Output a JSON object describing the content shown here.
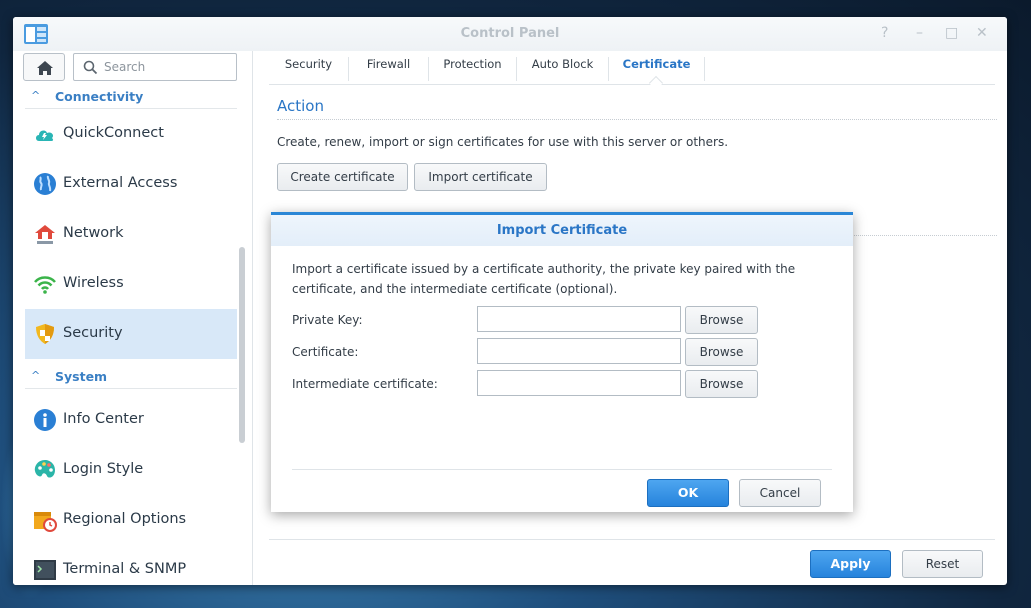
{
  "window": {
    "title": "Control Panel",
    "controls": {
      "help": "?",
      "minimize": "–",
      "maximize": "□",
      "close": "✕"
    }
  },
  "sidebar": {
    "search_placeholder": "Search",
    "groups": [
      {
        "label": "Connectivity",
        "chevron": "^"
      },
      {
        "label": "System",
        "chevron": "^"
      }
    ],
    "items": [
      {
        "label": "QuickConnect",
        "icon": "cloud-icon"
      },
      {
        "label": "External Access",
        "icon": "globe-icon"
      },
      {
        "label": "Network",
        "icon": "home-network-icon"
      },
      {
        "label": "Wireless",
        "icon": "wifi-icon"
      },
      {
        "label": "Security",
        "icon": "shield-icon",
        "active": true
      },
      {
        "label": "Info Center",
        "icon": "info-icon"
      },
      {
        "label": "Login Style",
        "icon": "palette-icon"
      },
      {
        "label": "Regional Options",
        "icon": "calendar-clock-icon"
      },
      {
        "label": "Terminal & SNMP",
        "icon": "terminal-icon"
      }
    ]
  },
  "tabs": [
    {
      "label": "Security"
    },
    {
      "label": "Firewall"
    },
    {
      "label": "Protection"
    },
    {
      "label": "Auto Block"
    },
    {
      "label": "Certificate",
      "active": true
    }
  ],
  "action": {
    "title": "Action",
    "description": "Create, renew, import or sign certificates for use with this server or others.",
    "create_button": "Create certificate",
    "import_button": "Import certificate"
  },
  "footer": {
    "apply": "Apply",
    "reset": "Reset"
  },
  "dialog": {
    "title": "Import Certificate",
    "description": "Import a certificate issued by a certificate authority, the private key paired with the certificate, and the intermediate certificate (optional).",
    "fields": [
      {
        "label": "Private Key:",
        "value": "",
        "browse": "Browse"
      },
      {
        "label": "Certificate:",
        "value": "",
        "browse": "Browse"
      },
      {
        "label": "Intermediate certificate:",
        "value": "",
        "browse": "Browse"
      }
    ],
    "ok": "OK",
    "cancel": "Cancel"
  },
  "colors": {
    "accent": "#2a76c6",
    "primary_button": "#2683dc",
    "active_bg": "#d8e8f8"
  }
}
